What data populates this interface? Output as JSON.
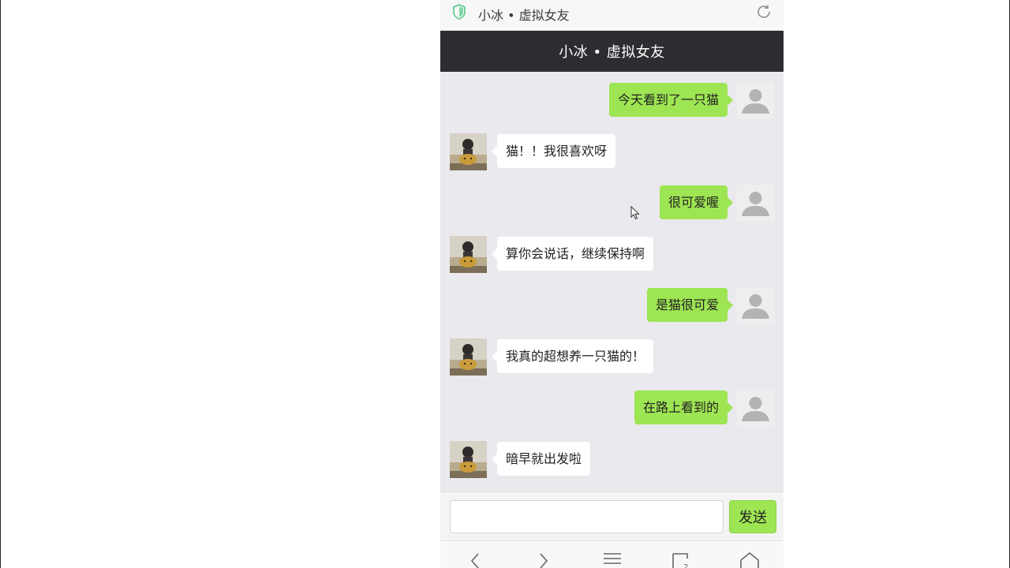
{
  "browser": {
    "url_title": "小冰 • 虚拟女友"
  },
  "header": {
    "title": "小冰 • 虚拟女友"
  },
  "messages": [
    {
      "from": "user",
      "text": "今天看到了一只猫"
    },
    {
      "from": "bot",
      "text": "猫！！我很喜欢呀"
    },
    {
      "from": "user",
      "text": "很可爱喔"
    },
    {
      "from": "bot",
      "text": "算你会说话，继续保持啊"
    },
    {
      "from": "user",
      "text": "是猫很可爱"
    },
    {
      "from": "bot",
      "text": "我真的超想养一只猫的！"
    },
    {
      "from": "user",
      "text": "在路上看到的"
    },
    {
      "from": "bot",
      "text": "暗早就出发啦"
    }
  ],
  "composer": {
    "input_value": "",
    "send_label": "发送"
  },
  "nav": {
    "tabs_count": "2"
  },
  "colors": {
    "header_bg": "#2b2d31",
    "user_bubble": "#9de552",
    "bot_bubble": "#ffffff",
    "chat_bg": "#e9e9ee"
  },
  "icons": {
    "urlbar": [
      "shield-icon",
      "reload-icon"
    ],
    "bottom_nav": [
      "back-icon",
      "forward-icon",
      "menu-icon",
      "tabs-icon",
      "home-icon"
    ]
  }
}
